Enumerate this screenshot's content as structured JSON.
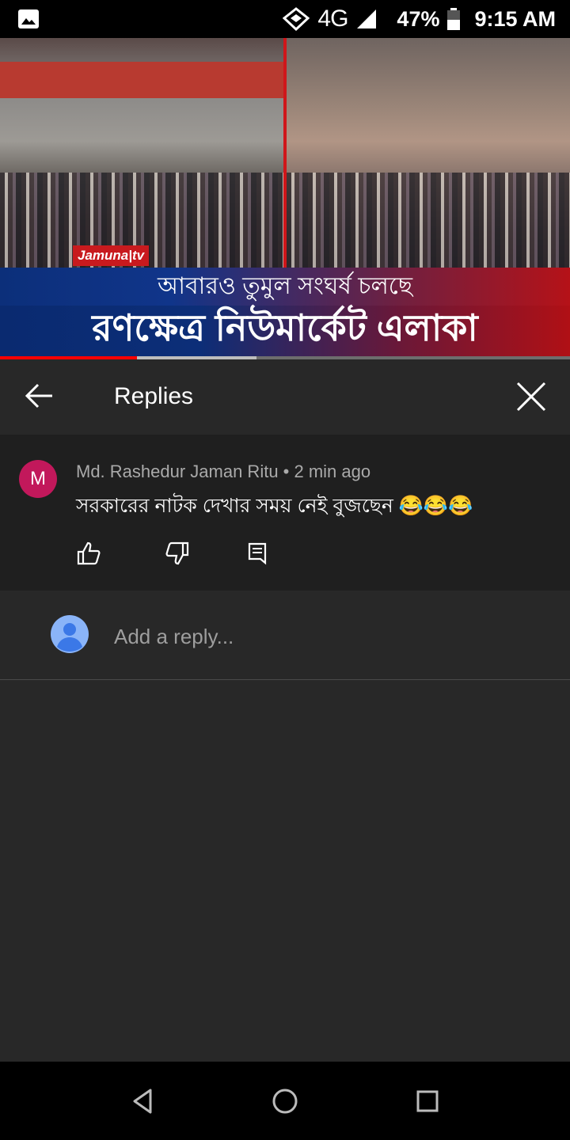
{
  "status_bar": {
    "network": "4G",
    "battery": "47%",
    "time": "9:15 AM"
  },
  "video": {
    "channel_logo": "Jamuna|tv",
    "ticker_top": "আবারও তুমুল সংঘর্ষ চলছে",
    "ticker_bottom": "রণক্ষেত্র নিউমার্কেট এলাকা",
    "progress_fraction": 0.24,
    "buffer_fraction": 0.45
  },
  "replies_header": {
    "title": "Replies",
    "back_icon": "arrow-left-icon",
    "close_icon": "close-icon"
  },
  "comment": {
    "avatar_letter": "M",
    "avatar_color": "#c2185b",
    "author": "Md. Rashedur Jaman Ritu",
    "separator": " • ",
    "time": "2 min ago",
    "text": "সরকারের নাটক  দেখার সময় নেই বুজছেন 😂😂😂",
    "actions": [
      "like-icon",
      "dislike-icon",
      "reply-icon"
    ]
  },
  "reply_box": {
    "placeholder": "Add a reply..."
  },
  "nav_bar": {
    "buttons": [
      "back-triangle-icon",
      "home-circle-icon",
      "recents-square-icon"
    ]
  }
}
